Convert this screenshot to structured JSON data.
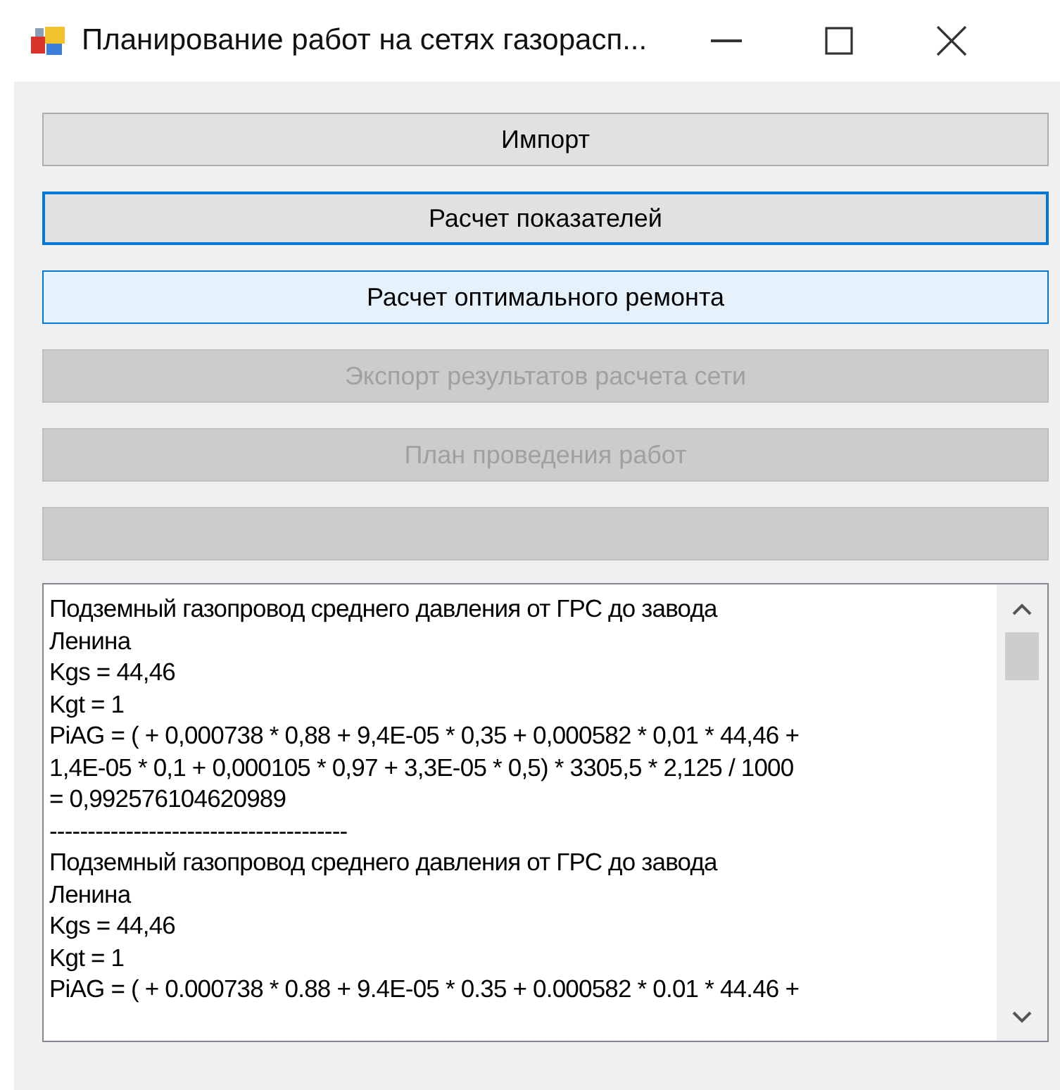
{
  "window": {
    "title": "Планирование работ на сетях газорасп..."
  },
  "buttons": [
    {
      "label": "Импорт",
      "focused": false,
      "hovered": false,
      "disabled": false
    },
    {
      "label": "Расчет показателей",
      "focused": true,
      "hovered": false,
      "disabled": false
    },
    {
      "label": "Расчет оптимального ремонта",
      "focused": false,
      "hovered": true,
      "disabled": false
    },
    {
      "label": "Экспорт результатов расчета сети",
      "focused": false,
      "hovered": false,
      "disabled": true
    },
    {
      "label": "План проведения работ",
      "focused": false,
      "hovered": false,
      "disabled": true
    },
    {
      "focused": false,
      "hovered": false,
      "disabled": true
    }
  ],
  "output": {
    "lines": [
      "Подземный газопровод среднего давления от ГРС до завода",
      "Ленина",
      "Kgs = 44,46",
      "Kgt = 1",
      "PiAG = ( + 0,000738 * 0,88 + 9,4E-05 * 0,35 + 0,000582 * 0,01 * 44,46 +",
      "1,4E-05 * 0,1 + 0,000105 * 0,97 + 3,3E-05 * 0,5) * 3305,5 * 2,125 / 1000",
      "= 0,992576104620989",
      "---------------------------------------",
      "Подземный газопровод среднего давления от ГРС до завода",
      "Ленина",
      "Kgs = 44,46",
      "Kgt = 1",
      "PiAG = ( + 0.000738 * 0.88 + 9.4E-05 * 0.35 + 0.000582 * 0.01 * 44.46 +"
    ]
  }
}
